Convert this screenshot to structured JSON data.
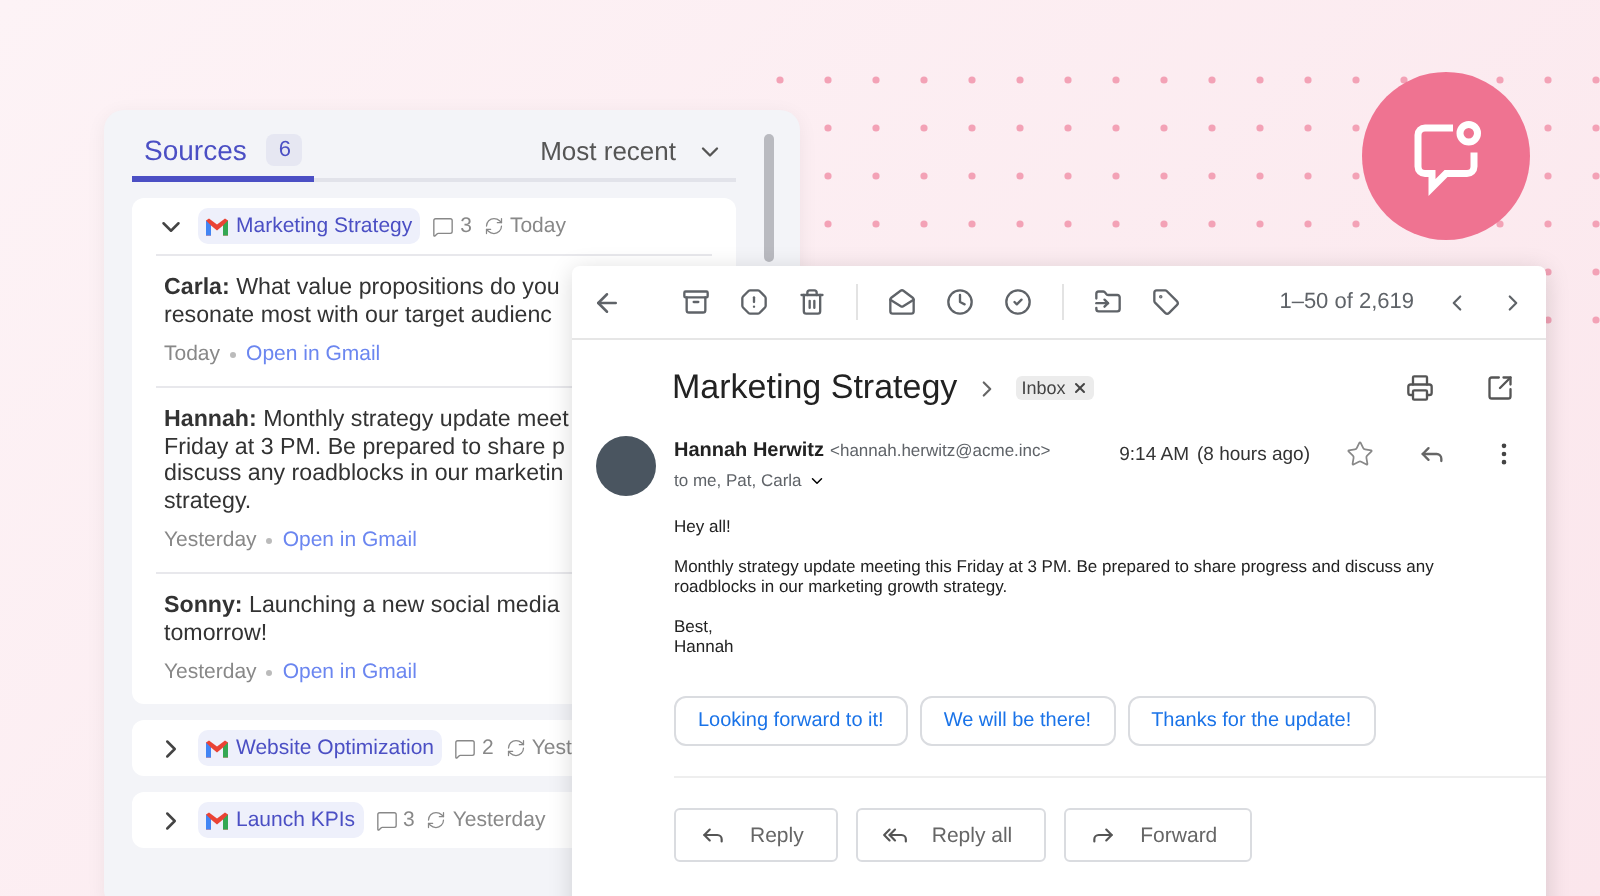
{
  "sources": {
    "tab": {
      "label": "Sources",
      "count": "6",
      "selected": true
    },
    "sort": "Most recent",
    "groups": [
      {
        "title": "Marketing Strategy",
        "comments": "3",
        "updated": "Today",
        "expanded": true,
        "messages": [
          {
            "text": "**Carla:** What value propositions do you resonate most with our target audienc",
            "date": "Today",
            "link": "Open in Gmail"
          },
          {
            "text": "**Hannah:** Monthly strategy update meet Friday at 3 PM. Be prepared to share p discuss any roadblocks in our marketin strategy.",
            "date": "Yesterday",
            "link": "Open in Gmail"
          },
          {
            "text": "**Sonny:** Launching a new social media tomorrow!",
            "date": "Yesterday",
            "link": "Open in Gmail"
          }
        ]
      },
      {
        "title": "Website Optimization",
        "comments": "2",
        "updated": "Yest",
        "expanded": false
      },
      {
        "title": "Launch KPIs",
        "comments": "3",
        "updated": "Yesterday",
        "expanded": false
      }
    ]
  },
  "gmail": {
    "counter": "1–50 of 2,619",
    "subject": "Marketing Strategy",
    "label": "Inbox",
    "sender": {
      "name": "Hannah Herwitz",
      "email": "<hannah.herwitz@acme.inc>",
      "to": "to me, Pat, Carla",
      "time": "9:14 AM",
      "ago": "(8 hours ago)",
      "starred": false
    },
    "body": [
      [
        "Hey all!"
      ],
      [
        "Monthly strategy update meeting this Friday at 3 PM. Be prepared to share progress and discuss any roadblocks in our marketing growth strategy."
      ],
      [
        "Best,",
        "Hannah"
      ]
    ],
    "smart_replies": [
      "Looking forward to it!",
      "We will be there!",
      "Thanks for the update!"
    ],
    "actions": [
      {
        "kind": "reply",
        "label": "Reply"
      },
      {
        "kind": "reply_all",
        "label": "Reply all"
      },
      {
        "kind": "forward",
        "label": "Forward"
      }
    ]
  }
}
